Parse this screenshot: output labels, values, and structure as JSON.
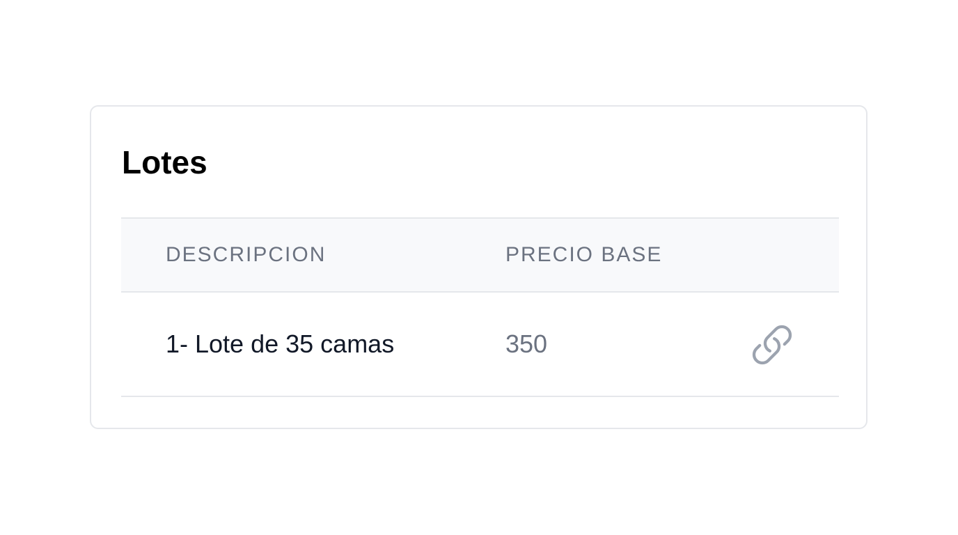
{
  "card": {
    "title": "Lotes"
  },
  "table": {
    "columns": [
      "DESCRIPCION",
      "PRECIO BASE",
      ""
    ],
    "rows": [
      {
        "descripcion": "1- Lote de 35 camas",
        "precio_base": "350",
        "action_icon": "link-icon"
      }
    ]
  },
  "colors": {
    "border": "#e5e7eb",
    "header_bg": "#f8f9fb",
    "muted_text": "#6b7280",
    "primary_text": "#111827",
    "icon": "#9ca3af"
  }
}
